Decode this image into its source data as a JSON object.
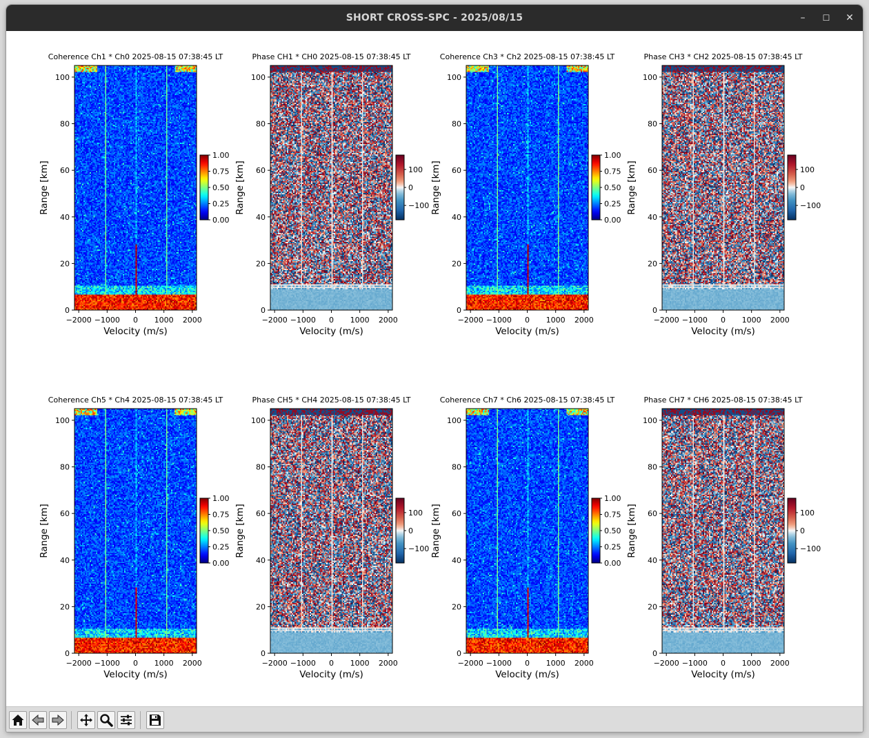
{
  "window": {
    "title": "SHORT CROSS-SPC - 2025/08/15",
    "controls": {
      "minimize": "–",
      "maximize": "☐",
      "close": "✕"
    }
  },
  "toolbar": {
    "buttons": [
      {
        "name": "home-button",
        "icon": "home-icon"
      },
      {
        "name": "back-button",
        "icon": "arrow-left-icon"
      },
      {
        "name": "forward-button",
        "icon": "arrow-right-icon"
      },
      {
        "name": "pan-button",
        "icon": "move-icon"
      },
      {
        "name": "zoom-button",
        "icon": "magnifier-icon"
      },
      {
        "name": "configure-subplots-button",
        "icon": "sliders-icon"
      },
      {
        "name": "save-button",
        "icon": "floppy-disk-icon"
      }
    ]
  },
  "chart_data": [
    {
      "type": "heatmap",
      "title": "Coherence Ch1 * Ch0 2025-08-15 07:38:45 LT",
      "xlabel": "Velocity (m/s)",
      "ylabel": "Range [km]",
      "xticks": [
        -2000,
        -1000,
        0,
        1000,
        2000
      ],
      "yticks": [
        0,
        20,
        40,
        60,
        80,
        100
      ],
      "xlim": [
        -2150,
        2150
      ],
      "ylim": [
        0,
        105
      ],
      "colormap": "jet",
      "colorbar_ticks": [
        "0.00",
        "0.25",
        "0.50",
        "0.75",
        "1.00"
      ],
      "zlim": [
        0,
        1
      ]
    },
    {
      "type": "heatmap",
      "title": "Phase CH1 * CH0 2025-08-15 07:38:45 LT",
      "xlabel": "Velocity (m/s)",
      "ylabel": "Range [km]",
      "xticks": [
        -2000,
        -1000,
        0,
        1000,
        2000
      ],
      "yticks": [
        0,
        20,
        40,
        60,
        80,
        100
      ],
      "xlim": [
        -2150,
        2150
      ],
      "ylim": [
        0,
        105
      ],
      "colormap": "RdBu_r",
      "colorbar_ticks": [
        "−100",
        "0",
        "100"
      ],
      "zlim": [
        -180,
        180
      ]
    },
    {
      "type": "heatmap",
      "title": "Coherence Ch3 * Ch2 2025-08-15 07:38:45 LT",
      "xlabel": "Velocity (m/s)",
      "ylabel": "Range [km]",
      "xticks": [
        -2000,
        -1000,
        0,
        1000,
        2000
      ],
      "yticks": [
        0,
        20,
        40,
        60,
        80,
        100
      ],
      "xlim": [
        -2150,
        2150
      ],
      "ylim": [
        0,
        105
      ],
      "colormap": "jet",
      "colorbar_ticks": [
        "0.00",
        "0.25",
        "0.50",
        "0.75",
        "1.00"
      ],
      "zlim": [
        0,
        1
      ]
    },
    {
      "type": "heatmap",
      "title": "Phase CH3 * CH2 2025-08-15 07:38:45 LT",
      "xlabel": "Velocity (m/s)",
      "ylabel": "Range [km]",
      "xticks": [
        -2000,
        -1000,
        0,
        1000,
        2000
      ],
      "yticks": [
        0,
        20,
        40,
        60,
        80,
        100
      ],
      "xlim": [
        -2150,
        2150
      ],
      "ylim": [
        0,
        105
      ],
      "colormap": "RdBu_r",
      "colorbar_ticks": [
        "−100",
        "0",
        "100"
      ],
      "zlim": [
        -180,
        180
      ]
    },
    {
      "type": "heatmap",
      "title": "Coherence Ch5 * Ch4 2025-08-15 07:38:45 LT",
      "xlabel": "Velocity (m/s)",
      "ylabel": "Range [km]",
      "xticks": [
        -2000,
        -1000,
        0,
        1000,
        2000
      ],
      "yticks": [
        0,
        20,
        40,
        60,
        80,
        100
      ],
      "xlim": [
        -2150,
        2150
      ],
      "ylim": [
        0,
        105
      ],
      "colormap": "jet",
      "colorbar_ticks": [
        "0.00",
        "0.25",
        "0.50",
        "0.75",
        "1.00"
      ],
      "zlim": [
        0,
        1
      ]
    },
    {
      "type": "heatmap",
      "title": "Phase CH5 * CH4 2025-08-15 07:38:45 LT",
      "xlabel": "Velocity (m/s)",
      "ylabel": "Range [km]",
      "xticks": [
        -2000,
        -1000,
        0,
        1000,
        2000
      ],
      "yticks": [
        0,
        20,
        40,
        60,
        80,
        100
      ],
      "xlim": [
        -2150,
        2150
      ],
      "ylim": [
        0,
        105
      ],
      "colormap": "RdBu_r",
      "colorbar_ticks": [
        "−100",
        "0",
        "100"
      ],
      "zlim": [
        -180,
        180
      ]
    },
    {
      "type": "heatmap",
      "title": "Coherence Ch7 * Ch6 2025-08-15 07:38:45 LT",
      "xlabel": "Velocity (m/s)",
      "ylabel": "Range [km]",
      "xticks": [
        -2000,
        -1000,
        0,
        1000,
        2000
      ],
      "yticks": [
        0,
        20,
        40,
        60,
        80,
        100
      ],
      "xlim": [
        -2150,
        2150
      ],
      "ylim": [
        0,
        105
      ],
      "colormap": "jet",
      "colorbar_ticks": [
        "0.00",
        "0.25",
        "0.50",
        "0.75",
        "1.00"
      ],
      "zlim": [
        0,
        1
      ]
    },
    {
      "type": "heatmap",
      "title": "Phase CH7 * CH6 2025-08-15 07:38:45 LT",
      "xlabel": "Velocity (m/s)",
      "ylabel": "Range [km]",
      "xticks": [
        -2000,
        -1000,
        0,
        1000,
        2000
      ],
      "yticks": [
        0,
        20,
        40,
        60,
        80,
        100
      ],
      "xlim": [
        -2150,
        2150
      ],
      "ylim": [
        0,
        105
      ],
      "colormap": "RdBu_r",
      "colorbar_ticks": [
        "−100",
        "0",
        "100"
      ],
      "zlim": [
        -180,
        180
      ]
    }
  ]
}
